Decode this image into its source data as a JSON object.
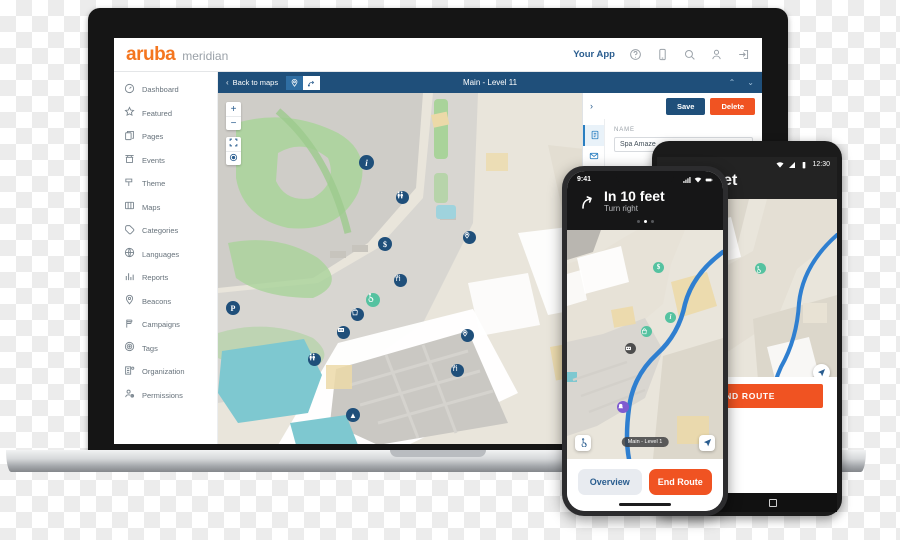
{
  "laptop": {
    "brand": {
      "name": "aruba",
      "product": "meridian"
    },
    "topnav": {
      "your_app": "Your App",
      "icons": [
        "help-icon",
        "mobile-icon",
        "search-icon",
        "user-icon",
        "logout-icon"
      ]
    },
    "sidebar": {
      "items": [
        {
          "label": "Dashboard",
          "icon": "dashboard-icon"
        },
        {
          "label": "Featured",
          "icon": "star-icon"
        },
        {
          "label": "Pages",
          "icon": "pages-icon"
        },
        {
          "label": "Events",
          "icon": "events-icon"
        },
        {
          "label": "Theme",
          "icon": "theme-icon"
        },
        {
          "label": "Maps",
          "icon": "maps-icon"
        },
        {
          "label": "Categories",
          "icon": "tag-icon"
        },
        {
          "label": "Languages",
          "icon": "languages-icon"
        },
        {
          "label": "Reports",
          "icon": "reports-icon"
        },
        {
          "label": "Beacons",
          "icon": "beacon-icon"
        },
        {
          "label": "Campaigns",
          "icon": "flag-icon"
        },
        {
          "label": "Tags",
          "icon": "rfid-icon"
        },
        {
          "label": "Organization",
          "icon": "organization-icon"
        },
        {
          "label": "Permissions",
          "icon": "permissions-icon"
        }
      ]
    },
    "mapbar": {
      "back_label": "Back to maps",
      "title": "Main - Level 11",
      "toggle_placemark": "placemark-icon",
      "toggle_route": "route-icon",
      "collapse": "⌃",
      "expand": "⌄"
    },
    "map_controls": {
      "zoom_in": "+",
      "zoom_out": "−",
      "fit": "fit-to-screen-icon",
      "locate": "locate-icon"
    },
    "panel": {
      "expand_chevron": "›",
      "save_label": "Save",
      "delete_label": "Delete",
      "field_label": "NAME",
      "field_value": "Spa Amaze",
      "rail_icons": [
        "page-info-icon",
        "mail-icon"
      ]
    }
  },
  "iphone": {
    "status": {
      "time": "9:41",
      "icons": [
        "signal-icon",
        "wifi-icon",
        "battery-icon"
      ]
    },
    "banner": {
      "arrow_icon": "turn-right-arrow-icon",
      "distance": "In 10 feet",
      "instruction": "Turn right",
      "dots": [
        false,
        true,
        false
      ]
    },
    "map": {
      "level_pill": "Main - Level 1",
      "accessibility_icon": "wheelchair-icon",
      "navigate_icon": "navigate-arrow-icon"
    },
    "cta": {
      "secondary": "Overview",
      "primary": "End Route"
    }
  },
  "android": {
    "status": {
      "time": "12:30",
      "icons": [
        "wifi-icon",
        "signal-icon",
        "battery-icon"
      ]
    },
    "header": {
      "title": "In 10 feet"
    },
    "map": {
      "navigate_icon": "navigate-arrow-icon"
    },
    "cta": {
      "primary": "END ROUTE"
    },
    "navbar": {
      "home": "home-circle-icon",
      "recents": "recents-square-icon"
    }
  },
  "colors": {
    "brand_orange": "#f4761f",
    "accent_navy": "#1f4f7a",
    "danger_orange": "#f05322",
    "link_blue": "#2a5d8f",
    "route_blue": "#2f7fd0",
    "map_base": "#e9e5db",
    "map_green": "#a9d39a",
    "map_water": "#7ec8d0"
  }
}
